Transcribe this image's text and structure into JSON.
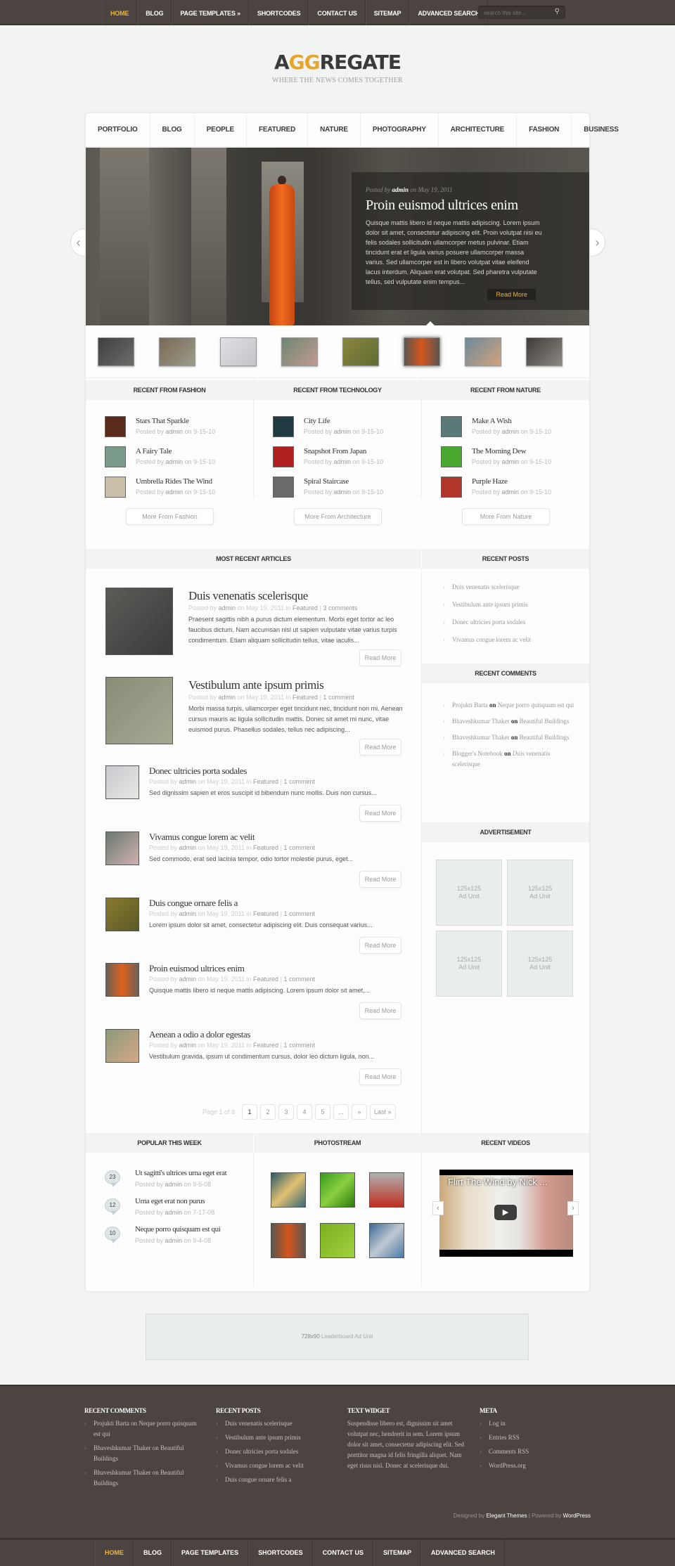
{
  "top_nav": {
    "items": [
      "HOME",
      "BLOG",
      "PAGE TEMPLATES »",
      "SHORTCODES",
      "CONTACT US",
      "SITEMAP",
      "ADVANCED SEARCH"
    ],
    "active_index": 0,
    "search_placeholder": "search this site..."
  },
  "brand": {
    "logo_pre": "A",
    "logo_gg": "GG",
    "logo_post": "REGATE",
    "tagline": "WHERE THE NEWS COMES TOGETHER"
  },
  "category_nav": [
    "PORTFOLIO",
    "BLOG",
    "PEOPLE",
    "FEATURED",
    "NATURE",
    "PHOTOGRAPHY »",
    "ARCHITECTURE",
    "FASHION",
    "BUSINESS"
  ],
  "slider": {
    "posted_by_prefix": "Posted by",
    "author": "admin",
    "date_text": "on May 19, 2011",
    "title": "Proin euismod ultrices enim",
    "excerpt": "Quisque mattis libero id neque mattis adipiscing. Lorem ipsum dolor sit amet, consectetur adipiscing elit. Proin volutpat nisi eu felis sodales sollicitudin ullamcorper metus pulvinar. Etiam tincidunt erat et ligula varius posuere ullamcorper massa varius. Sed ullamcorper est in libero volutpat vitae eleifend lacus interdum. Aliquam erat volutpat. Sed pharetra vulputate tellus, sed vulputate enim tempus...",
    "read_more": "Read More",
    "prev_icon": "‹",
    "next_icon": "›",
    "thumb_count": 8,
    "active_thumb": 6
  },
  "recent_blocks": [
    {
      "header": "RECENT FROM FASHION",
      "items": [
        {
          "title": "Stars That Sparkle",
          "author": "admin",
          "date": "9-15-10"
        },
        {
          "title": "A Fairy Tale",
          "author": "admin",
          "date": "9-15-10"
        },
        {
          "title": "Umbrella Rides The Wind",
          "author": "admin",
          "date": "9-15-10"
        }
      ],
      "more": "More From Fashion"
    },
    {
      "header": "RECENT FROM TECHNOLOGY",
      "items": [
        {
          "title": "City Life",
          "author": "admin",
          "date": "9-15-10"
        },
        {
          "title": "Snapshot From Japan",
          "author": "admin",
          "date": "9-15-10"
        },
        {
          "title": "Spiral Staircase",
          "author": "admin",
          "date": "9-15-10"
        }
      ],
      "more": "More From Architecture"
    },
    {
      "header": "RECENT FROM NATURE",
      "items": [
        {
          "title": "Make A Wish",
          "author": "admin",
          "date": "9-15-10"
        },
        {
          "title": "The Morning Dew",
          "author": "admin",
          "date": "9-15-10"
        },
        {
          "title": "Purple Haze",
          "author": "admin",
          "date": "9-15-10"
        }
      ],
      "more": "More From Nature"
    }
  ],
  "labels": {
    "posted_by": "Posted by",
    "on": "on",
    "in": "in",
    "sep": "|"
  },
  "articles_header": "MOST RECENT ARTICLES",
  "articles": [
    {
      "title": "Duis venenatis scelerisque",
      "author": "admin",
      "date": "May 19, 2011",
      "category": "Featured",
      "comments": "3 comments",
      "excerpt": "Praesent sagittis nibh a purus dictum elementum. Morbi eget tortor ac leo faucibus dictum. Nam accumsan nisl ut sapien vulputate vitae varius turpis condimentum. Etiam aliquam sollicitudin tellus, vitae iaculis...",
      "read_more": "Read More"
    },
    {
      "title": "Vestibulum ante ipsum primis",
      "author": "admin",
      "date": "May 19, 2011",
      "category": "Featured",
      "comments": "1 comment",
      "excerpt": "Morbi massa turpis, ullamcorper eget tincidunt nec, tincidunt non mi. Aenean cursus mauris ac ligula sollicitudin mattis. Donec sit amet mi nunc, vitae euismod purus. Phasellus sodales, tellus nec adipiscing...",
      "read_more": "Read More"
    },
    {
      "title": "Donec ultricies porta sodales",
      "author": "admin",
      "date": "May 19, 2011",
      "category": "Featured",
      "comments": "1 comment",
      "excerpt": "Sed dignissim sapien et eros suscipit id bibendum nunc mollis. Duis non cursus...",
      "read_more": "Read More"
    },
    {
      "title": "Vivamus congue lorem ac velit",
      "author": "admin",
      "date": "May 19, 2011",
      "category": "Featured",
      "comments": "1 comment",
      "excerpt": "Sed commodo, erat sed lacinia tempor, odio tortor molestie purus, eget...",
      "read_more": "Read More"
    },
    {
      "title": "Duis congue ornare felis a",
      "author": "admin",
      "date": "May 19, 2011",
      "category": "Featured",
      "comments": "1 comment",
      "excerpt": "Lorem ipsum dolor sit amet, consectetur adipiscing elit. Duis consequat varius...",
      "read_more": "Read More"
    },
    {
      "title": "Proin euismod ultrices enim",
      "author": "admin",
      "date": "May 19, 2011",
      "category": "Featured",
      "comments": "1 comment",
      "excerpt": "Quisque mattis libero id neque mattis adipiscing. Lorem ipsum dolor sit amet,...",
      "read_more": "Read More"
    },
    {
      "title": "Aenean a odio a dolor egestas",
      "author": "admin",
      "date": "May 19, 2011",
      "category": "Featured",
      "comments": "1 comment",
      "excerpt": "Vestibulum gravida, ipsum ut condimentum cursus, dolor leo dictum ligula, non...",
      "read_more": "Read More"
    }
  ],
  "pagination": {
    "label": "Page 1 of 8",
    "pages": [
      "1",
      "2",
      "3",
      "4",
      "5",
      "...",
      "»",
      "Last »"
    ],
    "current": "1"
  },
  "sidebar": {
    "recent_posts_header": "RECENT POSTS",
    "recent_posts": [
      "Duis venenatis scelerisque",
      "Vestibulum ante ipsum primis",
      "Donec ultricies porta sodales",
      "Vivamus congue lorem ac velit"
    ],
    "recent_comments_header": "RECENT COMMENTS",
    "recent_comments": [
      {
        "author": "Projukti Barta",
        "post": "Neque porro quisquam est qui"
      },
      {
        "author": "Bhaveshkumar Thaker",
        "post": "Beautiful Buildings"
      },
      {
        "author": "Bhaveshkumar Thaker",
        "post": "Beautiful Buildings"
      },
      {
        "author": "Blogger's Notebook",
        "post": "Duis venenatis scelerisque"
      }
    ],
    "advertisement_header": "ADVERTISEMENT",
    "ads": [
      {
        "size": "125x125",
        "label": "Ad Unit"
      },
      {
        "size": "125x125",
        "label": "Ad Unit"
      },
      {
        "size": "125x125",
        "label": "Ad Unit"
      },
      {
        "size": "125x125",
        "label": "Ad Unit"
      }
    ]
  },
  "bottom_widgets": {
    "popular_header": "POPULAR THIS WEEK",
    "popular": [
      {
        "count": "23",
        "title": "Ut sagitti's ultrices urna eget erat",
        "author": "admin",
        "date": "9-5-08"
      },
      {
        "count": "12",
        "title": "Urna eget erat non purus",
        "author": "admin",
        "date": "7-17-08"
      },
      {
        "count": "10",
        "title": "Neque porro quisquam est qui",
        "author": "admin",
        "date": "9-4-08"
      }
    ],
    "photostream_header": "PHOTOSTREAM",
    "photostream_count": 6,
    "videos_header": "RECENT VIDEOS",
    "video_title": "Flirt The Wind by Nick ...",
    "video_prev": "‹",
    "video_next": "›",
    "play_icon": "▶"
  },
  "leaderboard": {
    "size": "728x90",
    "label": "Leaderboard Ad Unit"
  },
  "footer": {
    "recent_comments_header": "RECENT COMMENTS",
    "recent_comments": [
      "Projukti Barta on Neque porro quisquam est qui",
      "Bhaveshkumar Thaker on Beautiful Buildings",
      "Bhaveshkumar Thaker on Beautiful Buildings"
    ],
    "recent_posts_header": "RECENT POSTS",
    "recent_posts": [
      "Duis venenatis scelerisque",
      "Vestibulum ante ipsum primis",
      "Donec ultricies porta sodales",
      "Vivamus congue lorem ac velit",
      "Duis congue ornare felis a"
    ],
    "text_widget_header": "TEXT WIDGET",
    "text_widget": "Suspendisse libero est, dignissim sit amet volutpat nec, hendrerit in sem. Lorem ipsum dolor sit amet, consectetur adipiscing elit. Sed porttitor magna id felis fringilla aliquet. Nam eget risus nisl. Donec at scelerisque dui.",
    "meta_header": "META",
    "meta": [
      "Log in",
      "Entries RSS",
      "Comments RSS",
      "WordPress.org"
    ],
    "designed_by": "Designed by",
    "designer": "Elegant Themes",
    "powered_by": "| Powered by",
    "platform": "WordPress"
  },
  "bottom_nav": {
    "items": [
      "HOME",
      "BLOG",
      "PAGE TEMPLATES",
      "SHORTCODES",
      "CONTACT US",
      "SITEMAP",
      "ADVANCED SEARCH"
    ],
    "active_index": 0
  },
  "colors": {
    "accent": "#e8b444",
    "bar": "#4b4441",
    "page_bg": "#f2f3f3"
  }
}
